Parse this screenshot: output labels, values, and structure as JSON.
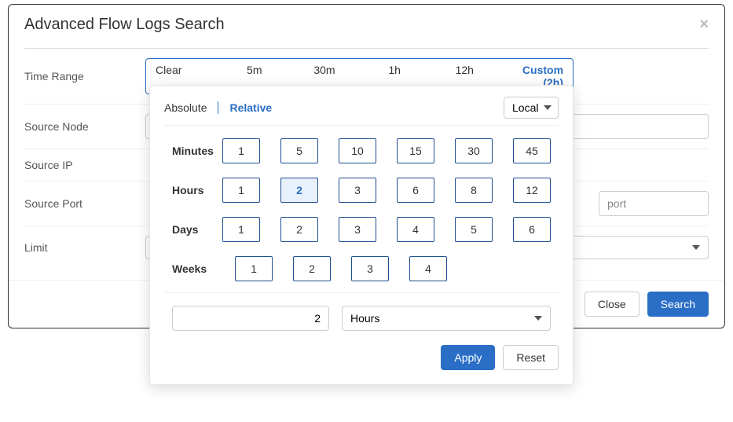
{
  "modal": {
    "title": "Advanced Flow Logs Search",
    "close_label": "×",
    "labels": {
      "time_range": "Time Range",
      "source_node": "Source Node",
      "source_ip": "Source IP",
      "source_port": "Source Port",
      "limit": "Limit"
    },
    "time_range": {
      "clear": "Clear",
      "t5m": "5m",
      "t30m": "30m",
      "t1h": "1h",
      "t12h": "12h",
      "custom": "Custom (2h)"
    },
    "port_placeholder": "port",
    "footer": {
      "close": "Close",
      "search": "Search"
    }
  },
  "popover": {
    "tabs": {
      "absolute": "Absolute",
      "relative": "Relative"
    },
    "tz_selected": "Local",
    "rows": {
      "minutes": {
        "label": "Minutes",
        "v1": "1",
        "v2": "5",
        "v3": "10",
        "v4": "15",
        "v5": "30",
        "v6": "45"
      },
      "hours": {
        "label": "Hours",
        "v1": "1",
        "v2": "2",
        "v3": "3",
        "v4": "6",
        "v5": "8",
        "v6": "12"
      },
      "days": {
        "label": "Days",
        "v1": "1",
        "v2": "2",
        "v3": "3",
        "v4": "4",
        "v5": "5",
        "v6": "6"
      },
      "weeks": {
        "label": "Weeks",
        "v1": "1",
        "v2": "2",
        "v3": "3",
        "v4": "4"
      }
    },
    "custom_input": {
      "value": "2",
      "unit": "Hours"
    },
    "footer": {
      "apply": "Apply",
      "reset": "Reset"
    }
  }
}
